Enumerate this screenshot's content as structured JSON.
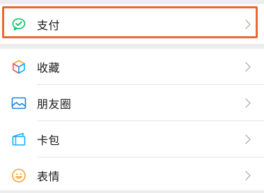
{
  "menu": {
    "payment": {
      "label": "支付",
      "icon": "wechat-pay-icon",
      "icon_color": "#07c160"
    },
    "items": [
      {
        "label": "收藏",
        "icon": "favorites-cube-icon"
      },
      {
        "label": "朋友圈",
        "icon": "moments-image-icon",
        "icon_color": "#1485ee"
      },
      {
        "label": "卡包",
        "icon": "card-wallet-icon",
        "icon_color": "#10aeff"
      },
      {
        "label": "表情",
        "icon": "sticker-smiley-icon",
        "icon_color": "#f0a72b"
      }
    ]
  },
  "annotation": {
    "highlight_color": "#e8682f"
  },
  "colors": {
    "background": "#ededed",
    "row": "#ffffff",
    "chevron": "#b2b2b2",
    "text": "#1a1a1a"
  }
}
